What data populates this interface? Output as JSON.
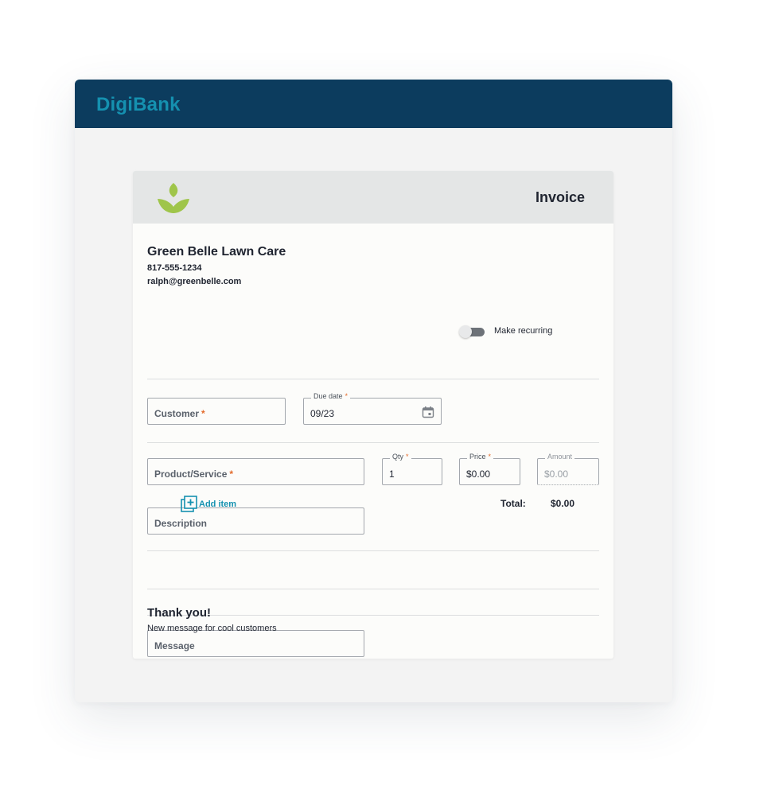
{
  "app": {
    "brand": "DigiBank"
  },
  "colors": {
    "header": "#0c3c5e",
    "brand": "#1591b0",
    "accent": "#1591b0",
    "required": "#e36b2c",
    "leaf": "#9fc54a"
  },
  "invoice": {
    "title": "Invoice",
    "logo_icon": "leaf-icon",
    "business": {
      "name": "Green Belle Lawn Care",
      "phone": "817-555-1234",
      "email": "ralph@greenbelle.com"
    },
    "customer": {
      "placeholder": "Customer",
      "required_mark": "*"
    },
    "due_date": {
      "label": "Due date",
      "required_mark": "*",
      "value": "09/23",
      "icon": "calendar-icon"
    },
    "recurring": {
      "label": "Make recurring",
      "enabled": false
    },
    "line_item": {
      "product": {
        "placeholder": "Product/Service",
        "required_mark": "*"
      },
      "qty": {
        "label": "Qty",
        "required_mark": "*",
        "value": "1"
      },
      "price": {
        "label": "Price",
        "required_mark": "*",
        "value": "$0.00"
      },
      "amount": {
        "label": "Amount",
        "value": "$0.00"
      },
      "description": {
        "placeholder": "Description"
      }
    },
    "add_item": {
      "label": "Add item",
      "icon": "add-item-icon"
    },
    "total": {
      "label": "Total:",
      "value": "$0.00"
    },
    "message": {
      "placeholder": "Message"
    },
    "footer": {
      "title": "Thank you!",
      "text": "New message for cool customers"
    }
  }
}
